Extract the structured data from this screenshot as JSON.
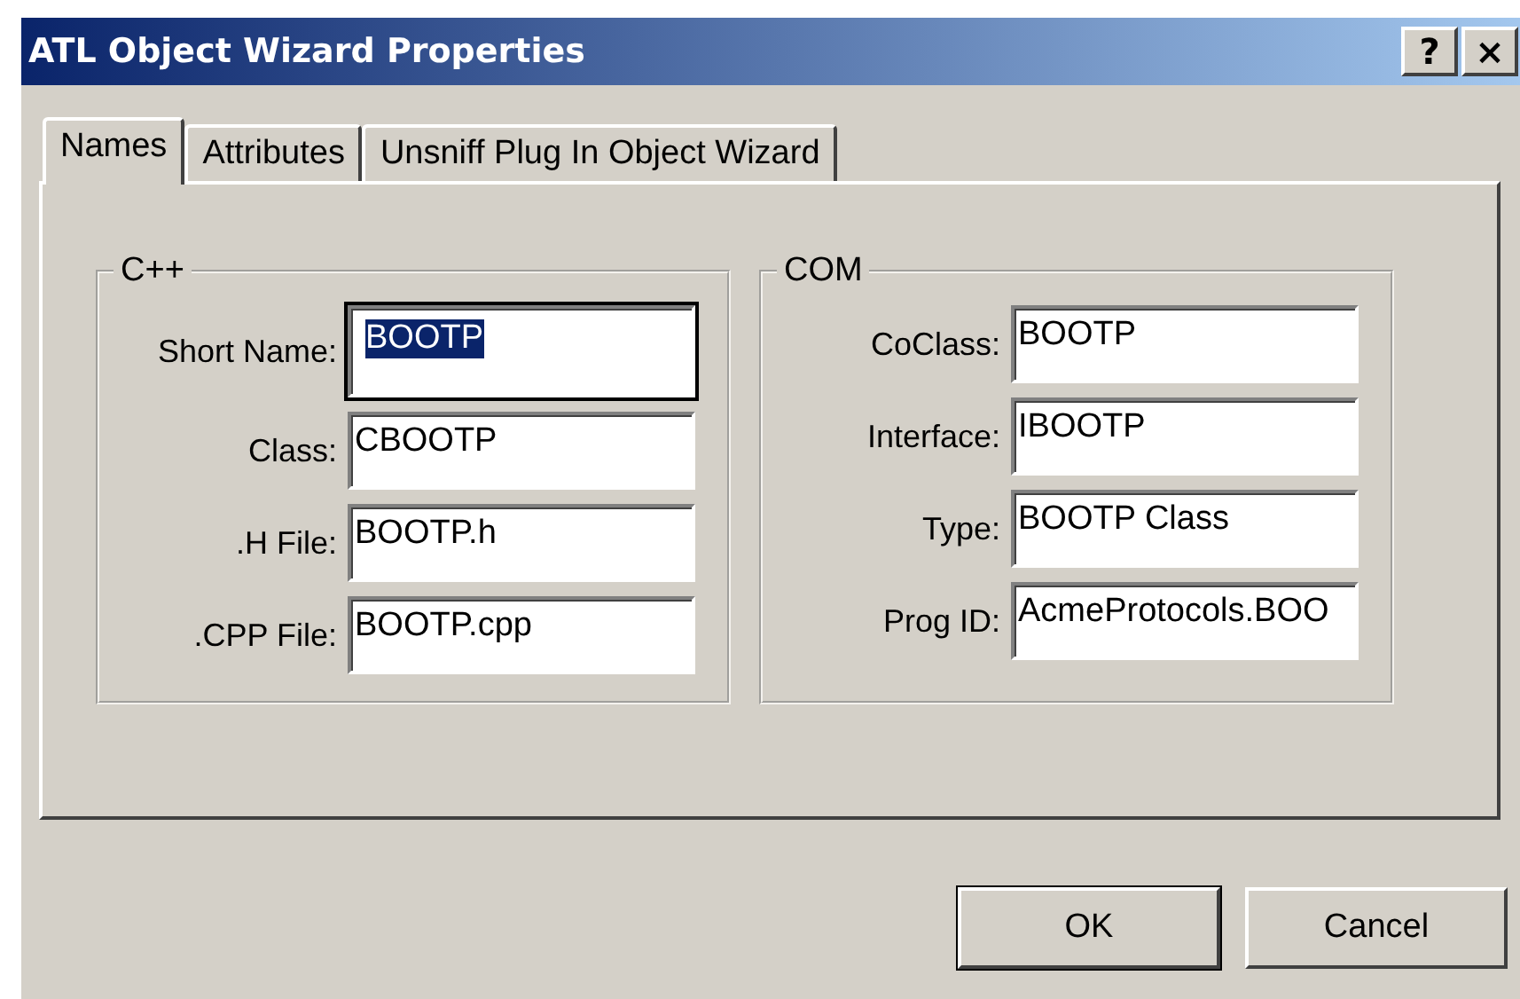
{
  "window": {
    "title": "ATL Object Wizard Properties",
    "title_buttons": [
      "?",
      "×"
    ]
  },
  "tabs": [
    {
      "label": "Names",
      "selected": true
    },
    {
      "label": "Attributes",
      "selected": false
    },
    {
      "label": "Unsniff Plug In Object Wizard",
      "selected": false
    }
  ],
  "groups": [
    {
      "title": "C++",
      "fields": [
        {
          "label": "Short Name:",
          "value": "BOOTP",
          "focused": true
        },
        {
          "label": "Class:",
          "value": "CBOOTP",
          "focused": false
        },
        {
          "label": ".H File:",
          "value": "BOOTP.h",
          "focused": false
        },
        {
          "label": ".CPP File:",
          "value": "BOOTP.cpp",
          "focused": false
        }
      ]
    },
    {
      "title": "COM",
      "fields": [
        {
          "label": "CoClass:",
          "value": "BOOTP",
          "focused": false
        },
        {
          "label": "Interface:",
          "value": "IBOOTP",
          "focused": false
        },
        {
          "label": "Type:",
          "value": "BOOTP Class",
          "focused": false
        },
        {
          "label": "Prog ID:",
          "value": "AcmeProtocols.BOO",
          "focused": false
        }
      ]
    }
  ],
  "buttons": [
    {
      "label": "OK",
      "default": true
    },
    {
      "label": "Cancel",
      "default": false
    }
  ]
}
